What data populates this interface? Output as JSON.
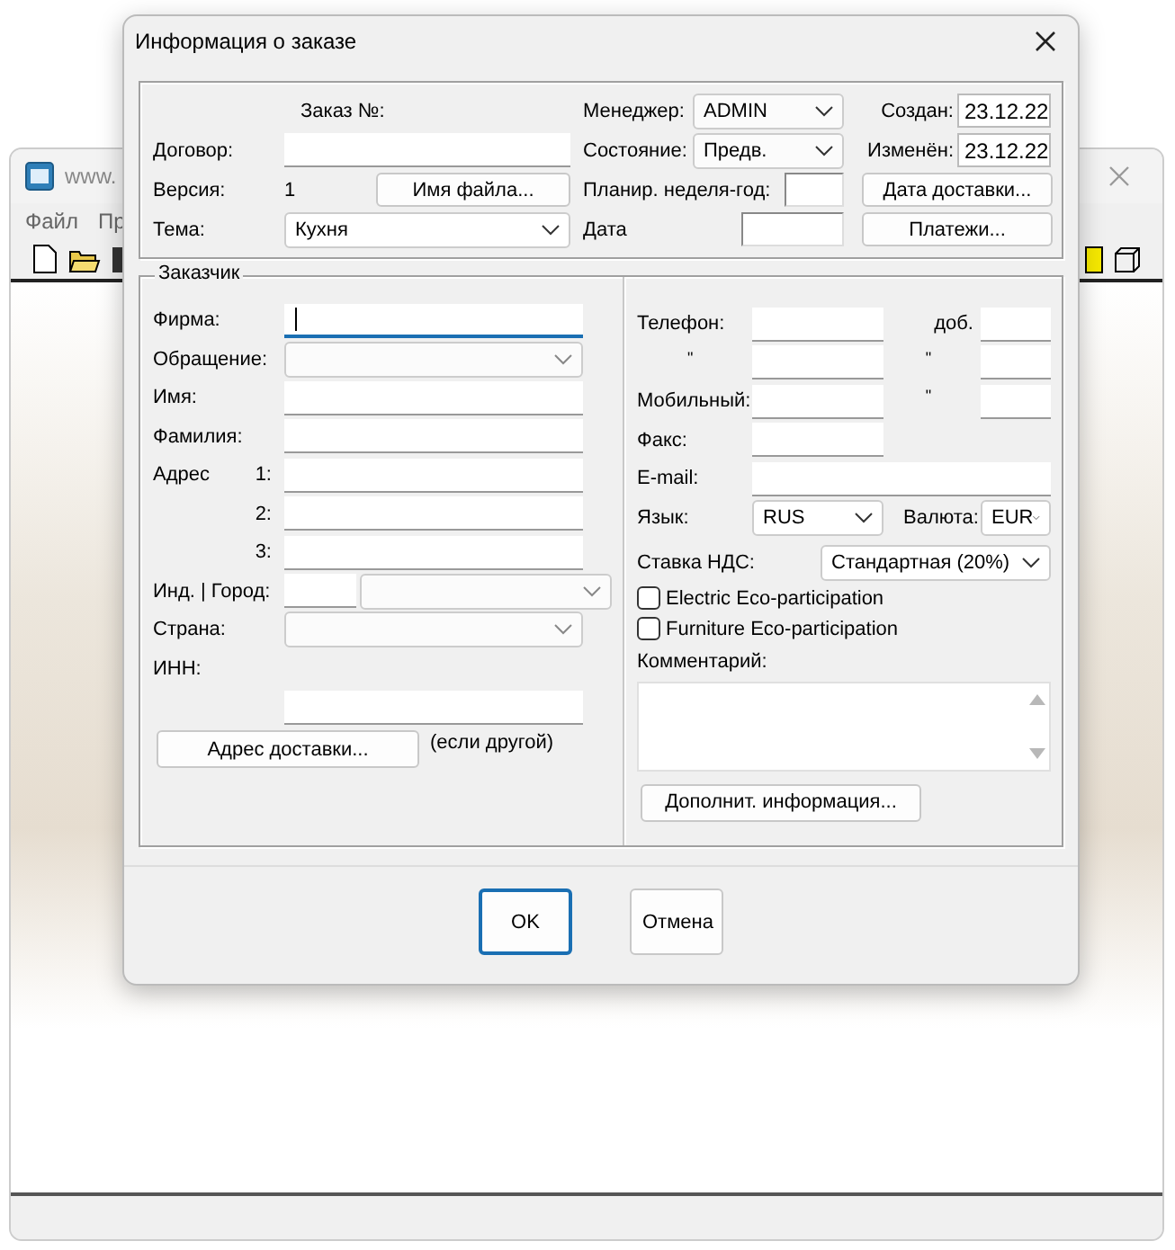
{
  "app": {
    "title": "www.",
    "menu": [
      "Файл",
      "Пр"
    ]
  },
  "dialog": {
    "title": "Информация о заказе",
    "order": {
      "order_no_label": "Заказ №:",
      "contract": {
        "label": "Договор:"
      },
      "version": {
        "label": "Версия:",
        "value": "1"
      },
      "filename_button": "Имя файла...",
      "theme": {
        "label": "Тема:",
        "value": "Кухня"
      },
      "manager": {
        "label": "Менеджер:",
        "value": "ADMIN"
      },
      "status": {
        "label": "Состояние:",
        "value": "Предв."
      },
      "planned_week": {
        "label": "Планир. неделя-год:"
      },
      "date": {
        "label": "Дата"
      },
      "created": {
        "label": "Создан:",
        "value": "23.12.22"
      },
      "modified": {
        "label": "Изменён:",
        "value": "23.12.22"
      },
      "delivery_date_button": "Дата доставки...",
      "payments_button": "Платежи..."
    },
    "customer": {
      "legend": "Заказчик",
      "firm": {
        "label": "Фирма:",
        "focused": true
      },
      "salutation": {
        "label": "Обращение:"
      },
      "first_name": {
        "label": "Имя:"
      },
      "last_name": {
        "label": "Фамилия:"
      },
      "address": {
        "label": "Адрес",
        "lines": [
          "1:",
          "2:",
          "3:"
        ]
      },
      "zip_city": {
        "label": "Инд. | Город:"
      },
      "country": {
        "label": "Страна:"
      },
      "inn": {
        "label": "ИНН:"
      },
      "delivery_address_button": "Адрес доставки...",
      "delivery_note": "(если другой)",
      "phones": [
        {
          "label": "Телефон:",
          "ext_label": "доб."
        },
        {
          "label": "\"",
          "ext_label": "\""
        },
        {
          "label": "Мобильный:",
          "ext_label": "\""
        }
      ],
      "fax": {
        "label": "Факс:"
      },
      "email": {
        "label": "E-mail:"
      },
      "language": {
        "label": "Язык:",
        "value": "RUS"
      },
      "currency": {
        "label": "Валюта:",
        "value": "EUR"
      },
      "vat": {
        "label": "Ставка НДС:",
        "value": "Стандартная (20%)"
      },
      "checkboxes": [
        {
          "label": "Electric Eco-participation",
          "checked": false
        },
        {
          "label": "Furniture Eco-participation",
          "checked": false
        }
      ],
      "comment": {
        "label": "Комментарий:"
      },
      "more_info_button": "Дополнит. информация..."
    },
    "buttons": [
      {
        "label": "OK",
        "default": true
      },
      {
        "label": "Отмена",
        "default": false
      }
    ]
  }
}
